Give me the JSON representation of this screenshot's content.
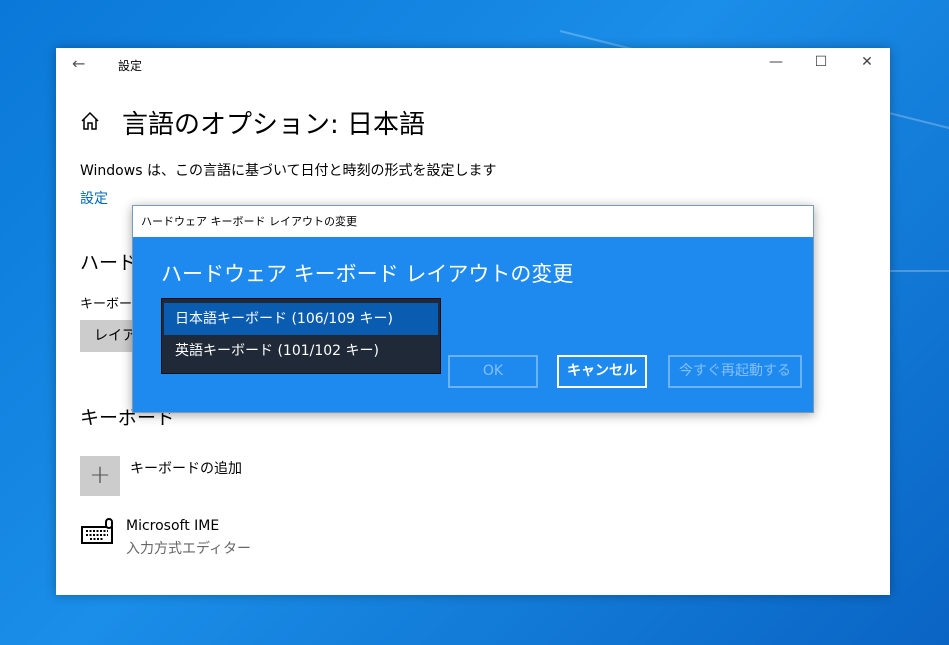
{
  "window": {
    "title": "設定",
    "back_icon": "arrow-left",
    "minimize": "—",
    "maximize": "☐",
    "close": "✕"
  },
  "page": {
    "title": "言語のオプション: 日本語",
    "home_icon": "home",
    "region_text": "Windows は、この言語に基づいて日付と時刻の形式を設定します",
    "region_link": "設定",
    "hw_heading": "ハードウ",
    "hw_label": "キーボード",
    "hw_button": "レイアウ",
    "keyboard_heading": "キーボード",
    "add_keyboard": "キーボードの追加",
    "plus": "+",
    "ime_name": "Microsoft IME",
    "ime_desc": "入力方式エディター"
  },
  "dialog": {
    "window_title": "ハードウェア キーボード レイアウトの変更",
    "heading": "ハードウェア キーボード レイアウトの変更",
    "options": [
      "日本語キーボード (106/109 キー)",
      "英語キーボード (101/102 キー)"
    ],
    "ok": "OK",
    "cancel": "キャンセル",
    "restart": "今すぐ再起動する"
  },
  "colors": {
    "dialog_bg": "#1e8af0",
    "dropdown_bg": "#1f2937",
    "selected": "#0a5cb0",
    "link": "#0067c0"
  }
}
